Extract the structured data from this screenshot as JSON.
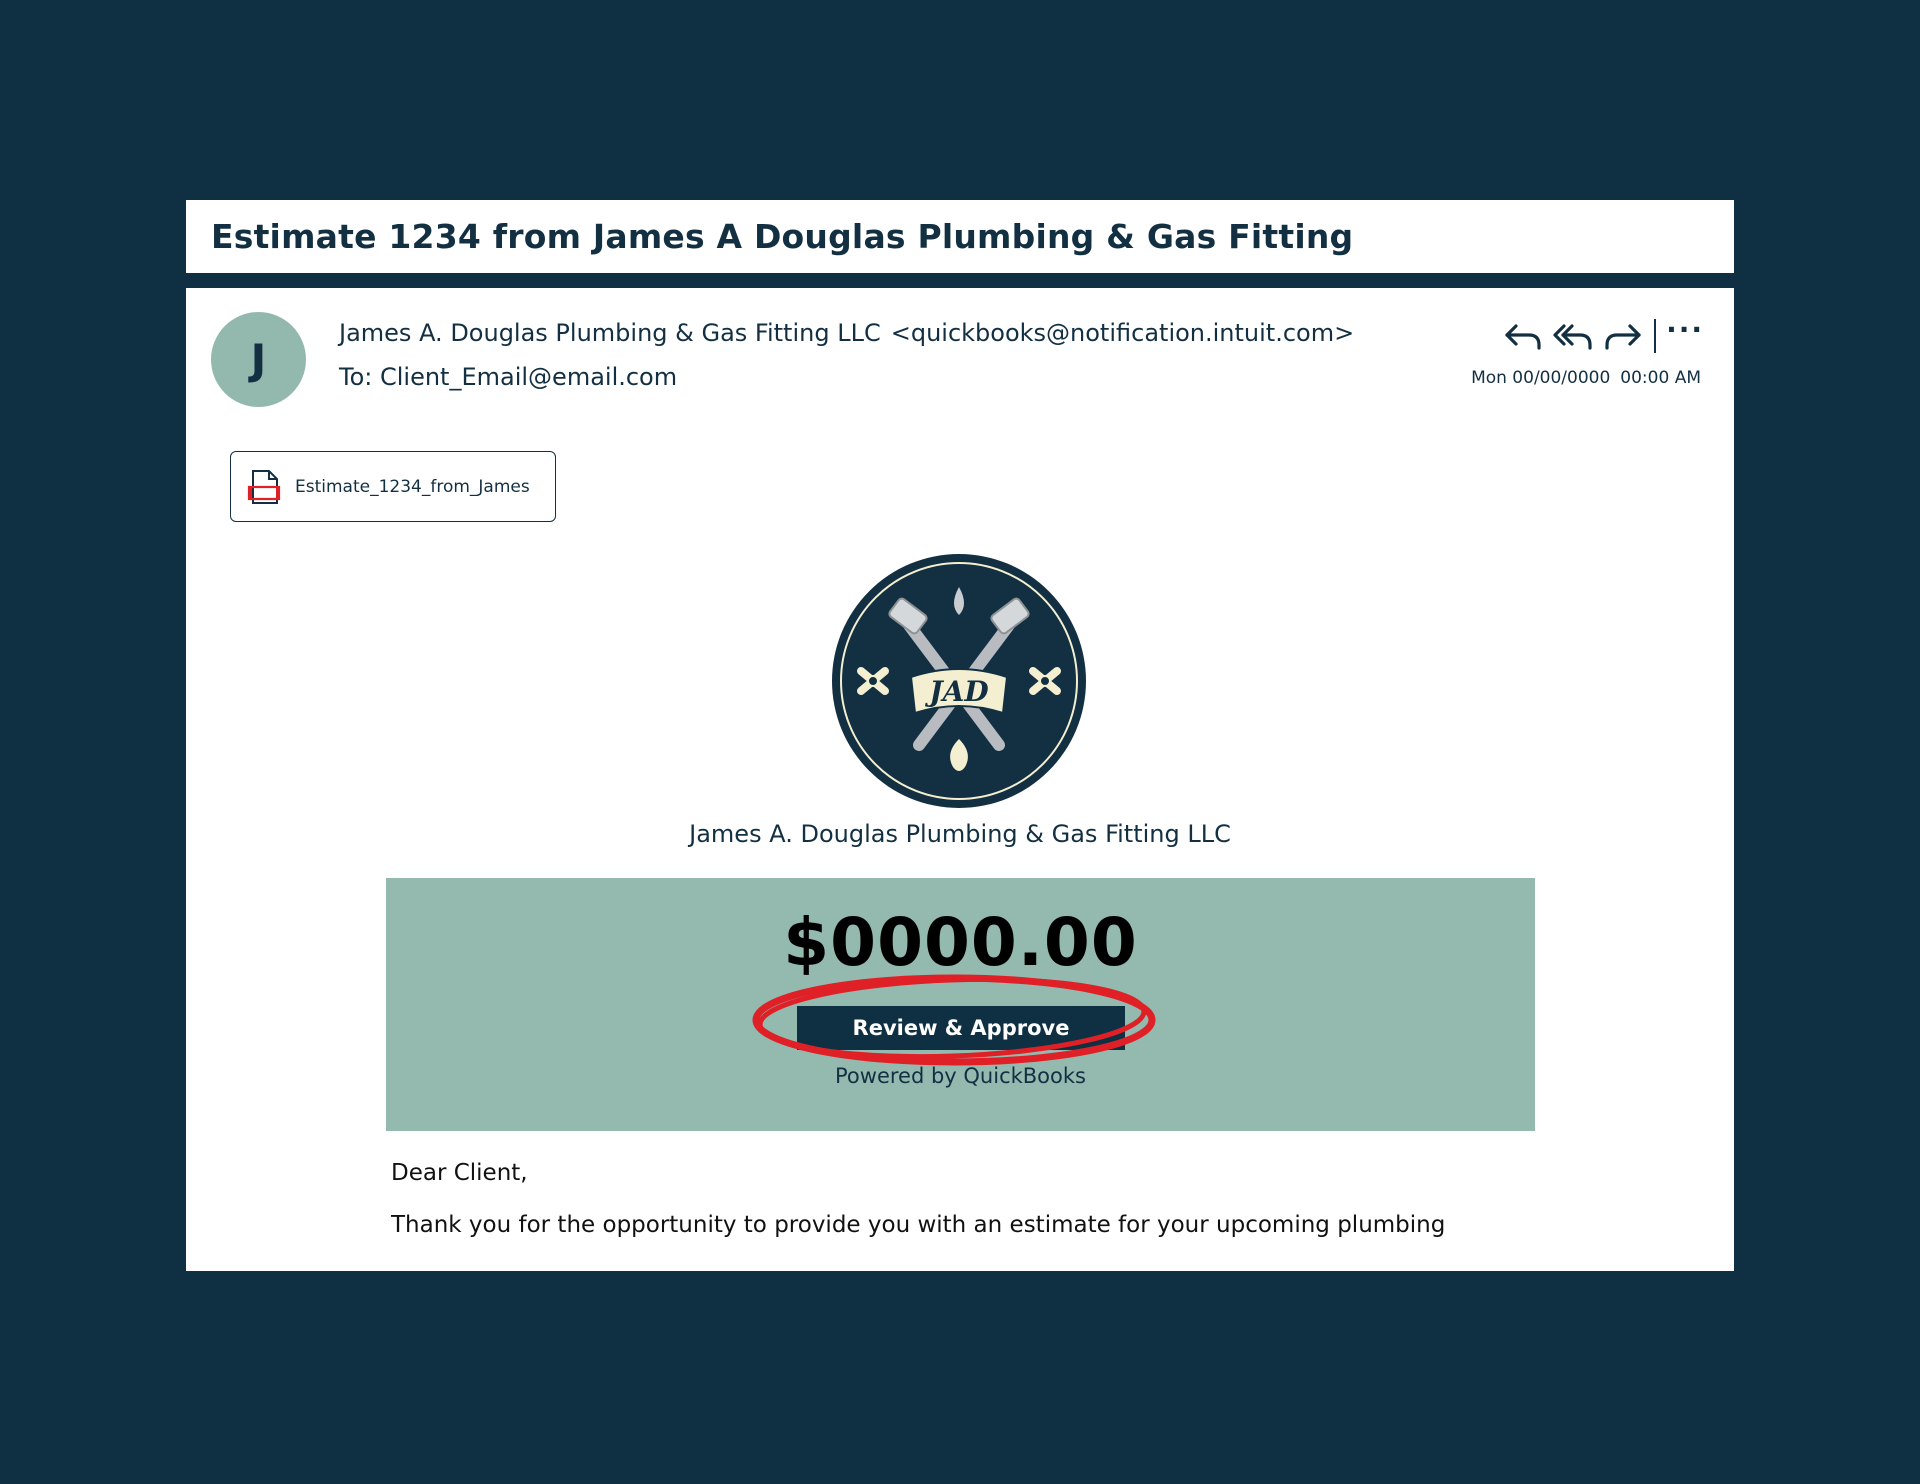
{
  "subject": "Estimate 1234 from James A Douglas Plumbing & Gas Fitting",
  "sender": {
    "initial": "J",
    "name": "James A. Douglas Plumbing & Gas Fitting LLC",
    "email": "<quickbooks@notification.intuit.com>"
  },
  "recipient": "To: Client_Email@email.com",
  "timestamp": {
    "date": "Mon 00/00/0000",
    "time": "00:00 AM"
  },
  "actions": {
    "reply_icon": "reply-icon",
    "reply_all_icon": "reply-all-icon",
    "forward_icon": "forward-icon",
    "more_label": "···"
  },
  "attachment": {
    "icon": "pdf-file-icon",
    "filename": "Estimate_1234_from_James"
  },
  "logo": {
    "monogram": "JAD"
  },
  "company_name": "James A. Douglas Plumbing & Gas Fitting LLC",
  "banner": {
    "amount": "$0000.00",
    "button_label": "Review & Approve",
    "powered_by": "Powered by QuickBooks"
  },
  "body": {
    "greeting": "Dear Client,",
    "paragraph": "Thank you for the opportunity to provide you with an estimate for your upcoming plumbing"
  },
  "colors": {
    "background": "#0e3042",
    "accent": "#94b9ae",
    "button": "#0e3042",
    "highlight": "#e02027",
    "text": "#133043"
  }
}
